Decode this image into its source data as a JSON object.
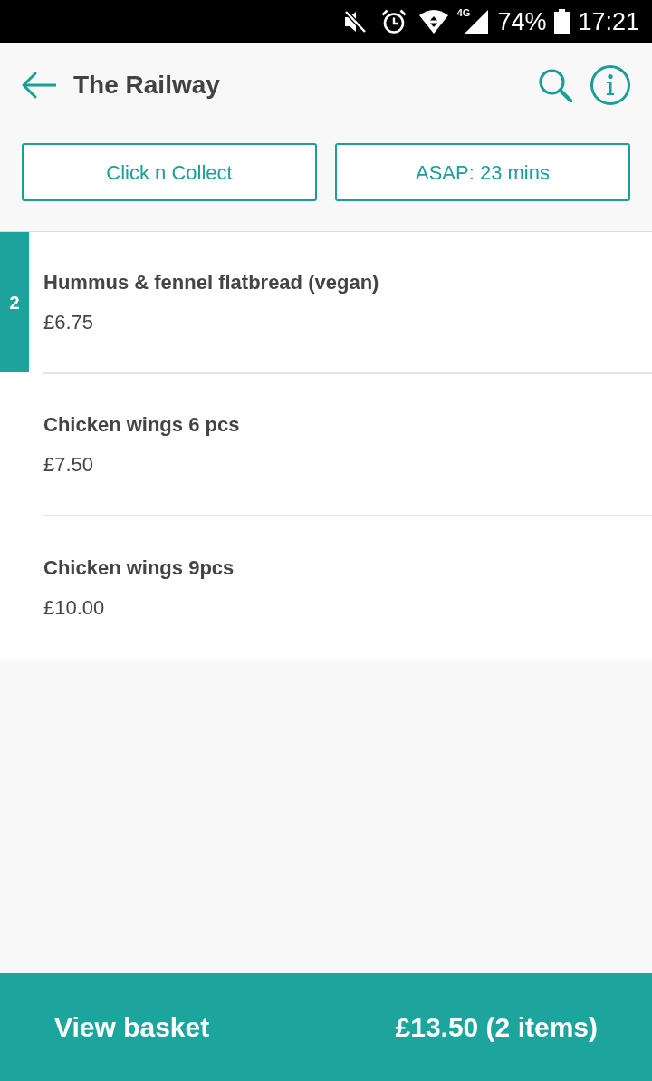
{
  "status_bar": {
    "network": "4G",
    "battery": "74%",
    "time": "17:21"
  },
  "app_bar": {
    "title": "The Railway"
  },
  "options": [
    {
      "label": "Click n Collect"
    },
    {
      "label": "ASAP: 23 mins"
    }
  ],
  "menu_items": [
    {
      "name": "Hummus & fennel flatbread (vegan)",
      "price": "£6.75",
      "quantity": "2"
    },
    {
      "name": "Chicken wings 6 pcs",
      "price": "£7.50"
    },
    {
      "name": "Chicken wings 9pcs",
      "price": "£10.00"
    }
  ],
  "basket_bar": {
    "label": "View basket",
    "summary": "£13.50 (2 items)"
  }
}
